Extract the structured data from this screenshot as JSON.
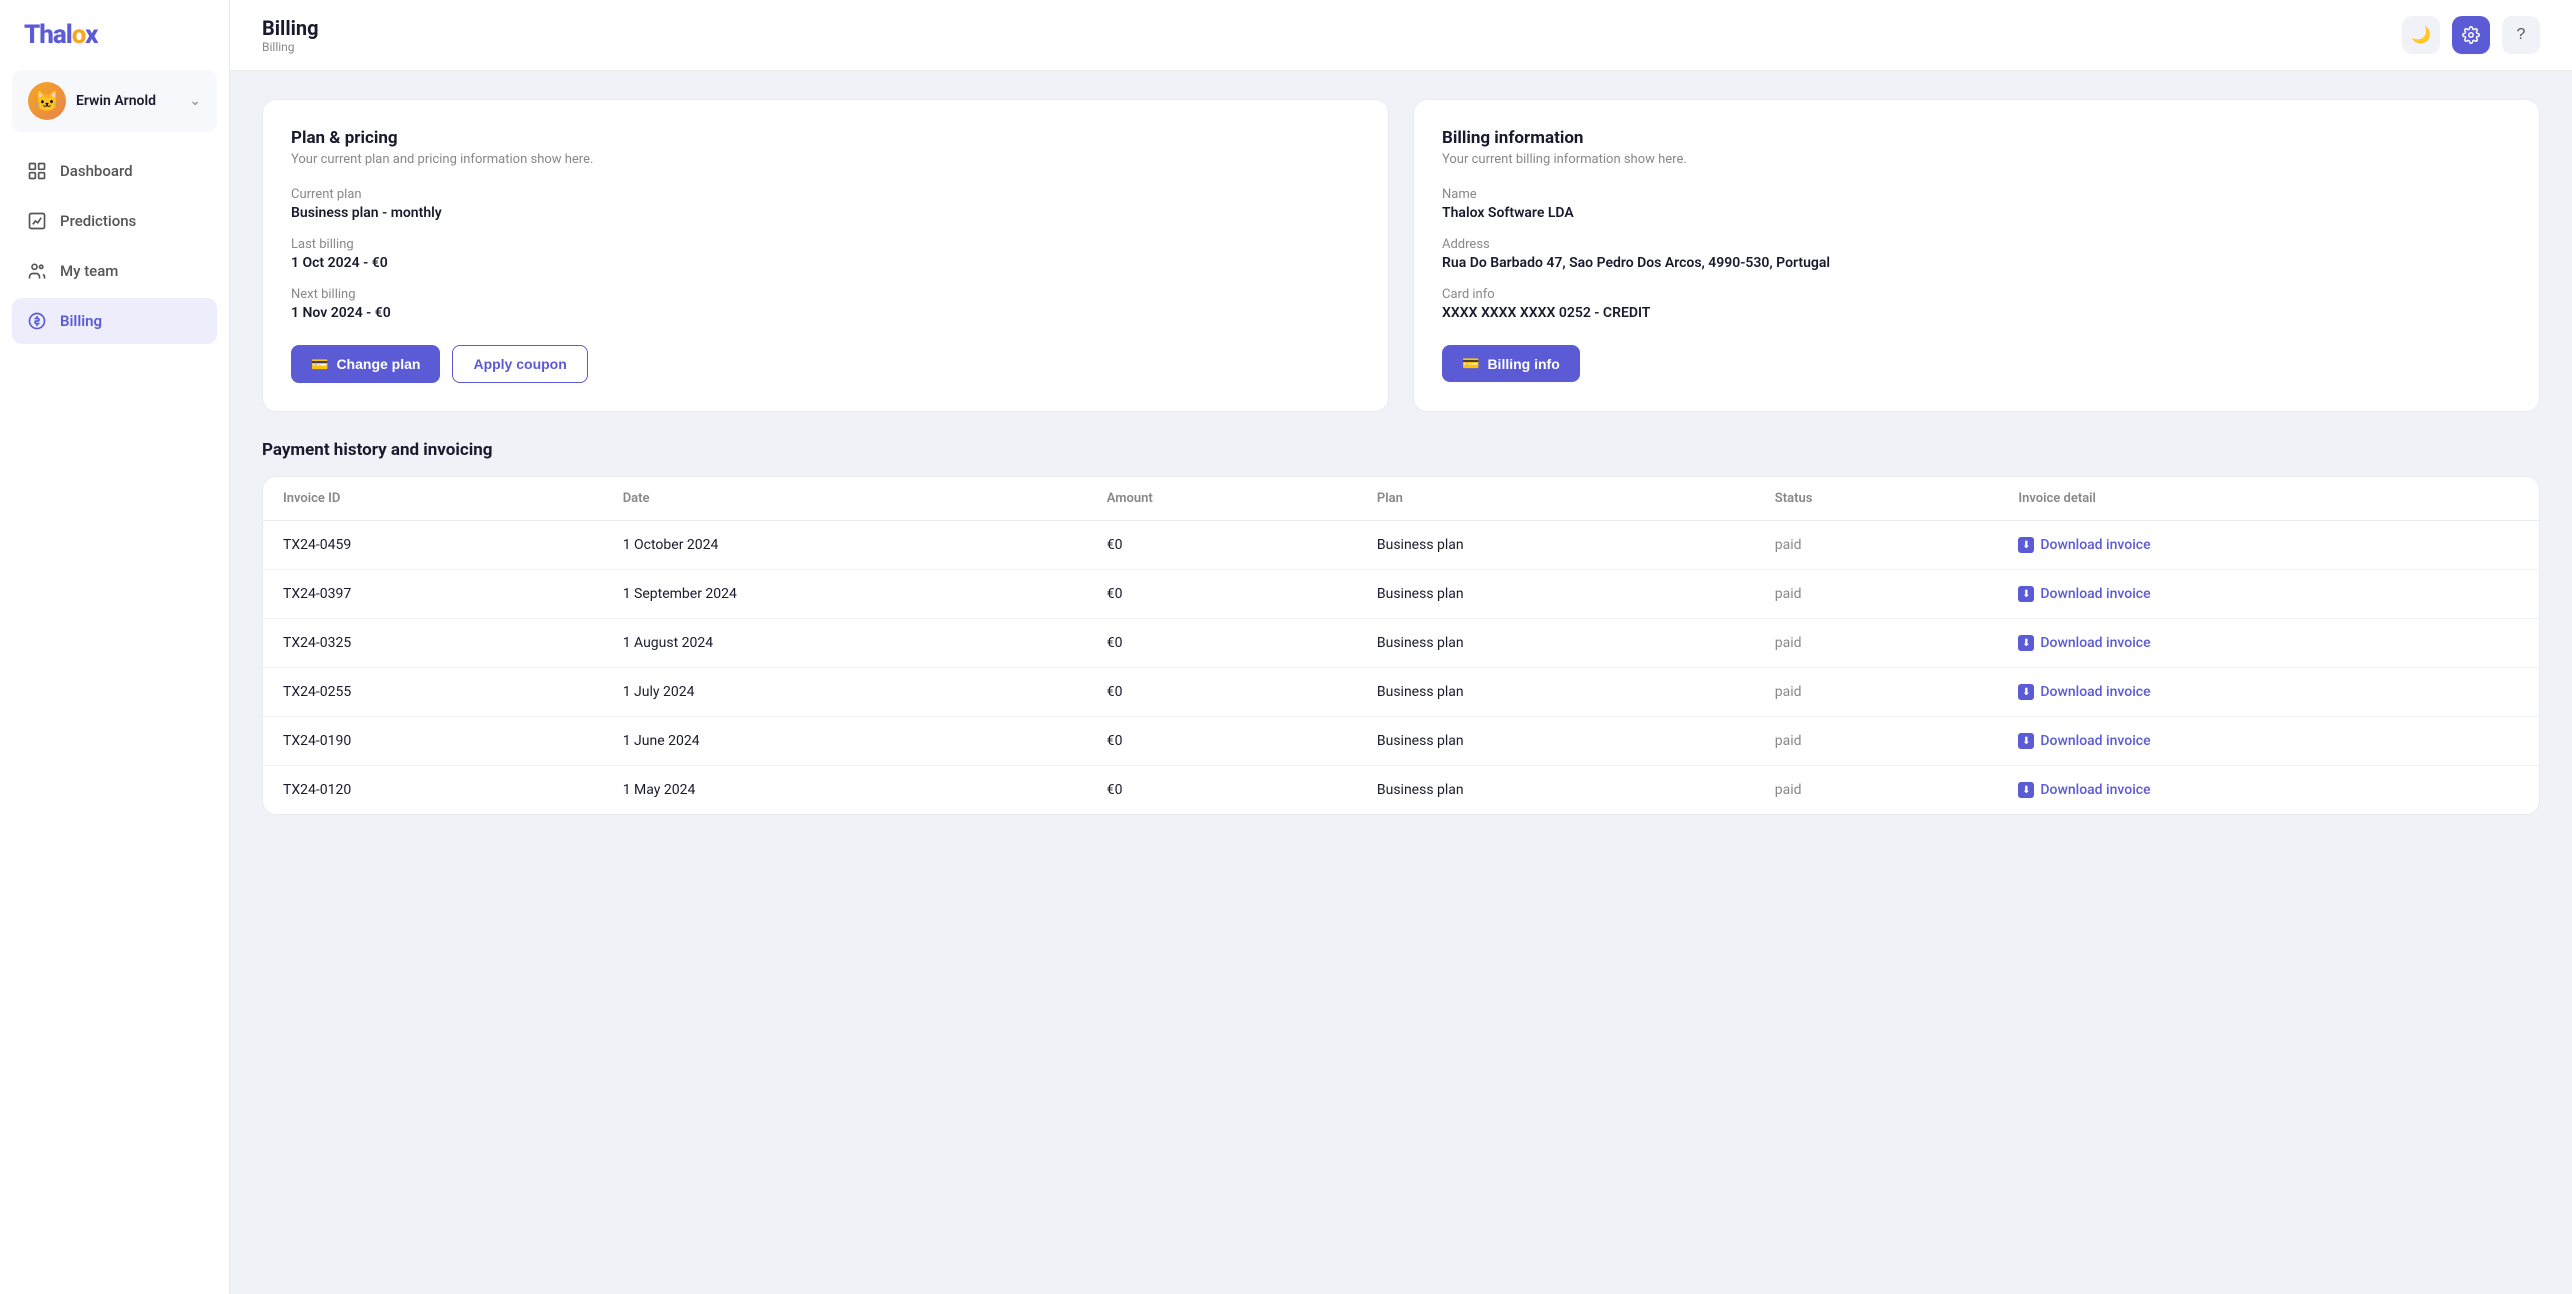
{
  "app": {
    "logo_text": "Thalox"
  },
  "user": {
    "name": "Erwin Arnold",
    "avatar_emoji": "🐱"
  },
  "nav": {
    "items": [
      {
        "id": "dashboard",
        "label": "Dashboard",
        "icon": "grid"
      },
      {
        "id": "predictions",
        "label": "Predictions",
        "icon": "chart"
      },
      {
        "id": "my-team",
        "label": "My team",
        "icon": "team"
      },
      {
        "id": "billing",
        "label": "Billing",
        "icon": "billing",
        "active": true
      }
    ]
  },
  "header": {
    "title": "Billing",
    "breadcrumb": "Billing",
    "theme_icon": "🌙",
    "settings_icon": "⚙",
    "help_icon": "?"
  },
  "plan_card": {
    "title": "Plan & pricing",
    "subtitle": "Your current plan and pricing information show here.",
    "current_plan_label": "Current plan",
    "current_plan_value": "Business plan - monthly",
    "last_billing_label": "Last billing",
    "last_billing_value": "1 Oct 2024 - €0",
    "next_billing_label": "Next billing",
    "next_billing_value": "1 Nov 2024 - €0",
    "change_plan_btn": "Change plan",
    "apply_coupon_btn": "Apply coupon"
  },
  "billing_card": {
    "title": "Billing information",
    "subtitle": "Your current billing information show here.",
    "name_label": "Name",
    "name_value": "Thalox Software LDA",
    "address_label": "Address",
    "address_value": "Rua Do Barbado 47, Sao Pedro Dos Arcos, 4990-530, Portugal",
    "card_label": "Card info",
    "card_value": "XXXX XXXX XXXX 0252 - CREDIT",
    "billing_info_btn": "Billing info"
  },
  "payment_history": {
    "section_title": "Payment history and invoicing",
    "columns": {
      "invoice_id": "Invoice ID",
      "date": "Date",
      "amount": "Amount",
      "plan": "Plan",
      "status": "Status",
      "invoice_detail": "Invoice detail"
    },
    "rows": [
      {
        "id": "TX24-0459",
        "date": "1 October 2024",
        "amount": "€0",
        "plan": "Business plan",
        "status": "paid",
        "link": "Download invoice"
      },
      {
        "id": "TX24-0397",
        "date": "1 September 2024",
        "amount": "€0",
        "plan": "Business plan",
        "status": "paid",
        "link": "Download invoice"
      },
      {
        "id": "TX24-0325",
        "date": "1 August 2024",
        "amount": "€0",
        "plan": "Business plan",
        "status": "paid",
        "link": "Download invoice"
      },
      {
        "id": "TX24-0255",
        "date": "1 July 2024",
        "amount": "€0",
        "plan": "Business plan",
        "status": "paid",
        "link": "Download invoice"
      },
      {
        "id": "TX24-0190",
        "date": "1 June 2024",
        "amount": "€0",
        "plan": "Business plan",
        "status": "paid",
        "link": "Download invoice"
      },
      {
        "id": "TX24-0120",
        "date": "1 May 2024",
        "amount": "€0",
        "plan": "Business plan",
        "status": "paid",
        "link": "Download invoice"
      }
    ]
  }
}
